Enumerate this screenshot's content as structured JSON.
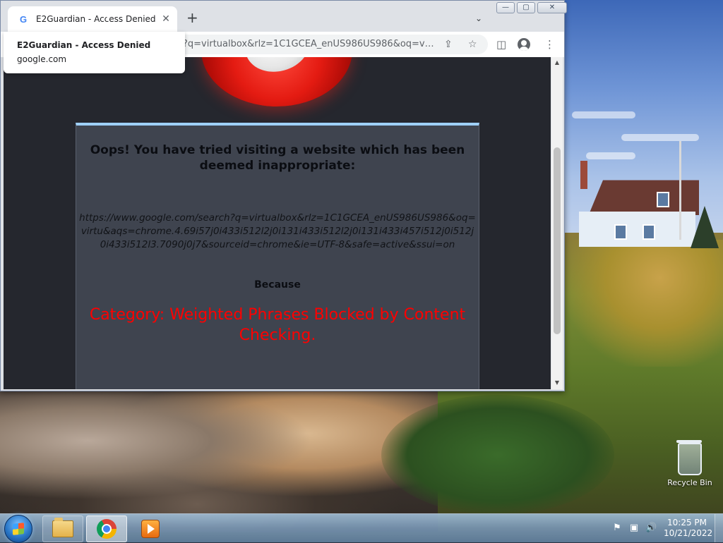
{
  "desktop": {
    "recycle_bin_label": "Recycle Bin"
  },
  "browser": {
    "tab": {
      "favicon": "G",
      "title": "E2Guardian - Access Denied",
      "close_glyph": "✕"
    },
    "new_tab_glyph": "+",
    "tab_search_glyph": "⌄",
    "caption": {
      "minimize": "—",
      "maximize": "▢",
      "close": "✕"
    },
    "url": "?q=virtualbox&rlz=1C1GCEA_enUS986US986&oq=virt...",
    "tooltip": {
      "title": "E2Guardian - Access Denied",
      "host": "google.com"
    },
    "icons": {
      "share": "share-icon",
      "bookmark": "star-icon",
      "side_panel": "side-panel-icon",
      "profile": "profile-icon",
      "menu": "kebab-menu-icon"
    }
  },
  "page": {
    "heading": "Oops! You have tried visiting a website which has been deemed inappropriate:",
    "blocked_url": "https://www.google.com/search?q=virtualbox&rlz=1C1GCEA_enUS986US986&oq=virtu&aqs=chrome.4.69i57j0i433i512l2j0i131i433i512l2j0i131i433i457i512j0i512j0i433i512l3.7090j0j7&sourceid=chrome&ie=UTF-8&safe=active&ssui=on",
    "because_label": "Because",
    "category_text": "Category: Weighted Phrases  Blocked by Content Checking."
  },
  "taskbar": {
    "time": "10:25 PM",
    "date": "10/21/2022",
    "pinned": [
      "File Explorer",
      "Google Chrome",
      "Windows Media Player"
    ]
  },
  "colors": {
    "accent_red": "#ff0000",
    "message_box_bg": "#3f444f",
    "page_bg": "#25272e",
    "message_box_border": "#9fd0ff"
  }
}
